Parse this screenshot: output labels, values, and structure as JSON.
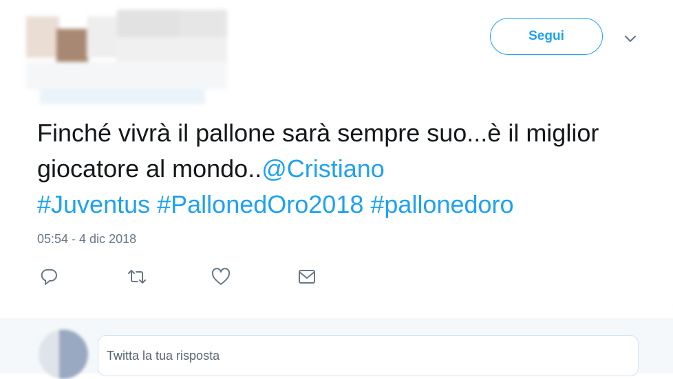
{
  "header": {
    "follow_label": "Segui",
    "menu_icon": "chevron-down-icon"
  },
  "tweet": {
    "text_plain": "Finché vivrà il pallone sarà sempre suo...è il miglior giocatore al mondo..",
    "mention": "@Cristiano",
    "hashtags": [
      "#Juventus",
      "#PallonedOro2018",
      "#pallonedoro"
    ],
    "timestamp": "05:54 - 4 dic 2018"
  },
  "actions": [
    {
      "name": "reply",
      "icon": "reply-icon"
    },
    {
      "name": "retweet",
      "icon": "retweet-icon"
    },
    {
      "name": "like",
      "icon": "heart-icon"
    },
    {
      "name": "direct-message",
      "icon": "envelope-icon"
    }
  ],
  "reply": {
    "placeholder": "Twitta la tua risposta"
  },
  "colors": {
    "accent": "#1da1f2",
    "text": "#14171a",
    "muted": "#657786",
    "reply_bg": "#f5f8fa"
  }
}
